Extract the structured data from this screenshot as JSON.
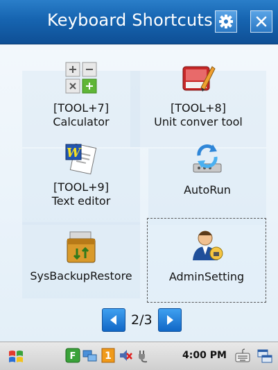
{
  "window": {
    "title": "Keyboard Shortcuts",
    "settings_icon": "gear-icon",
    "close_label": "X"
  },
  "shortcuts": [
    {
      "key": "[TOOL+7]",
      "name": "Calculator",
      "icon": "calculator-icon"
    },
    {
      "key": "[TOOL+8]",
      "name": "Unit conver tool",
      "icon": "unit-converter-icon"
    },
    {
      "key": "[TOOL+9]",
      "name": "Text editor",
      "icon": "text-editor-icon"
    },
    {
      "key": "",
      "name": "AutoRun",
      "icon": "autorun-icon"
    },
    {
      "key": "",
      "name": "SysBackupRestore",
      "icon": "backup-restore-icon"
    },
    {
      "key": "",
      "name": "AdminSetting",
      "icon": "admin-setting-icon"
    }
  ],
  "pager": {
    "current": 2,
    "total": 3,
    "text": "2/3"
  },
  "taskbar": {
    "clock": "4:00 PM",
    "icons": [
      "windows-start-icon",
      "f-app-icon",
      "network-icon",
      "one-app-icon",
      "sound-muted-icon",
      "power-plug-icon",
      "keyboard-icon",
      "window-switch-icon"
    ]
  },
  "colors": {
    "titlebar": "#1664b0",
    "accent": "#1f78d1",
    "selection_border": "#555555"
  }
}
